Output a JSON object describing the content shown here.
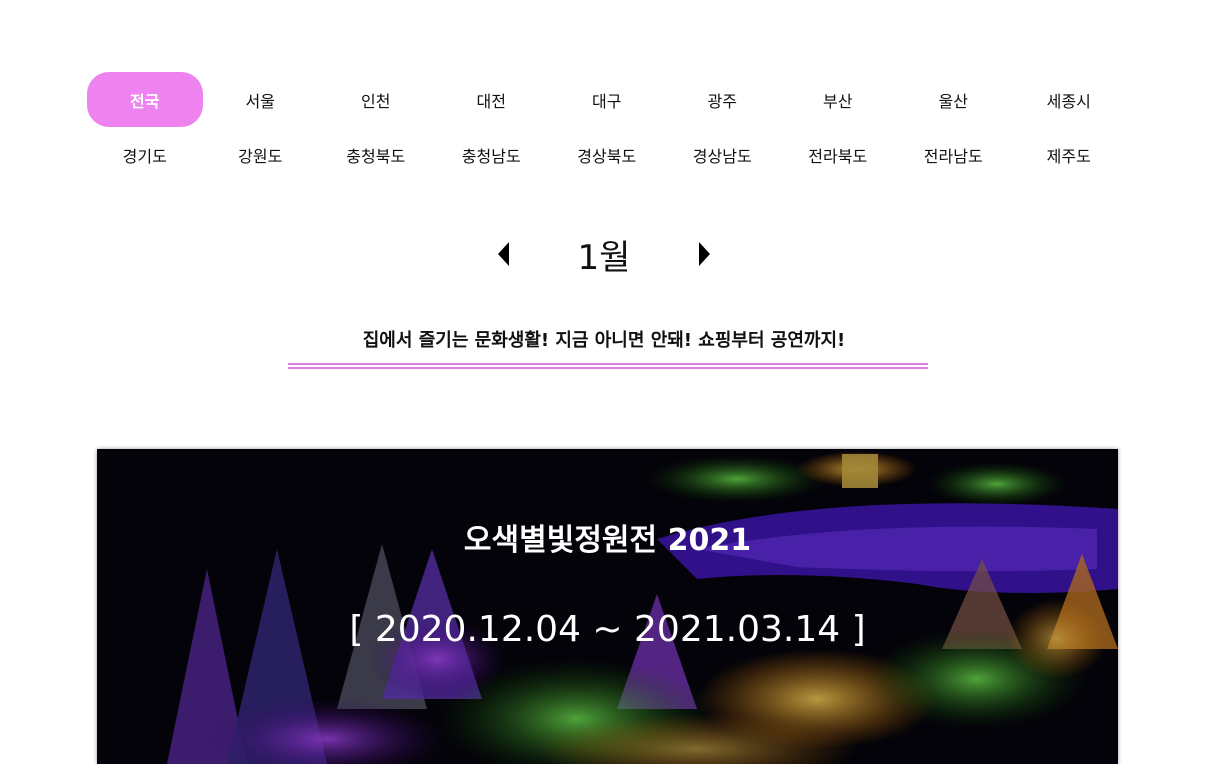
{
  "regions": {
    "row1": [
      "전국",
      "서울",
      "인천",
      "대전",
      "대구",
      "광주",
      "부산",
      "울산",
      "세종시"
    ],
    "row2": [
      "경기도",
      "강원도",
      "충청북도",
      "충청남도",
      "경상북도",
      "경상남도",
      "전라북도",
      "전라남도",
      "제주도"
    ],
    "active": "전국"
  },
  "month": {
    "label": "1월",
    "prev_icon": "caret-left-icon",
    "next_icon": "caret-right-icon"
  },
  "headline": "집에서 즐기는 문화생활! 지금 아니면 안돼! 쇼핑부터 공연까지!",
  "banner": {
    "title": "오색별빛정원전 2021",
    "date": "[ 2020.12.04 ~ 2021.03.14 ]"
  },
  "colors": {
    "accent": "#ee82ee",
    "rule": "#e07ae0"
  }
}
